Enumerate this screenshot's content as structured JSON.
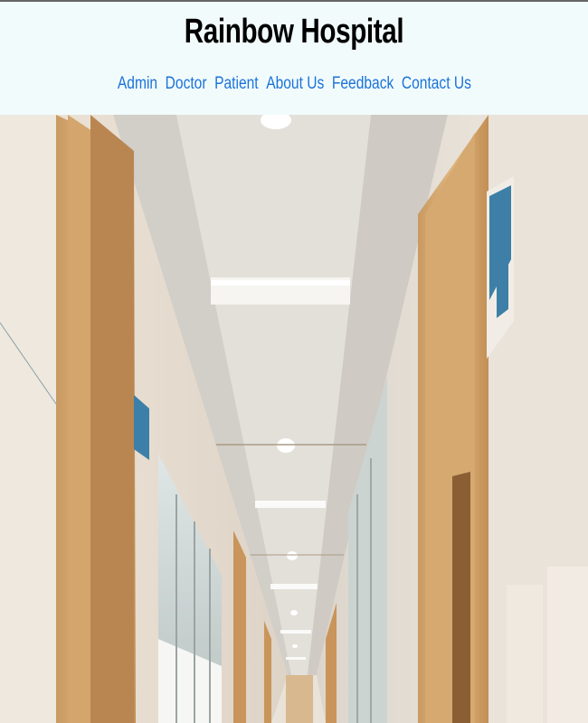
{
  "site": {
    "title": "Rainbow Hospital"
  },
  "nav": {
    "items": [
      {
        "label": "Admin"
      },
      {
        "label": "Doctor"
      },
      {
        "label": "Patient"
      },
      {
        "label": "About Us"
      },
      {
        "label": "Feedback"
      },
      {
        "label": "Contact Us"
      }
    ]
  },
  "hero": {
    "description_icon": "hospital-corridor-image"
  },
  "colors": {
    "header_bg": "#f2fbfc",
    "link": "#1a73d9",
    "title": "#000000"
  }
}
